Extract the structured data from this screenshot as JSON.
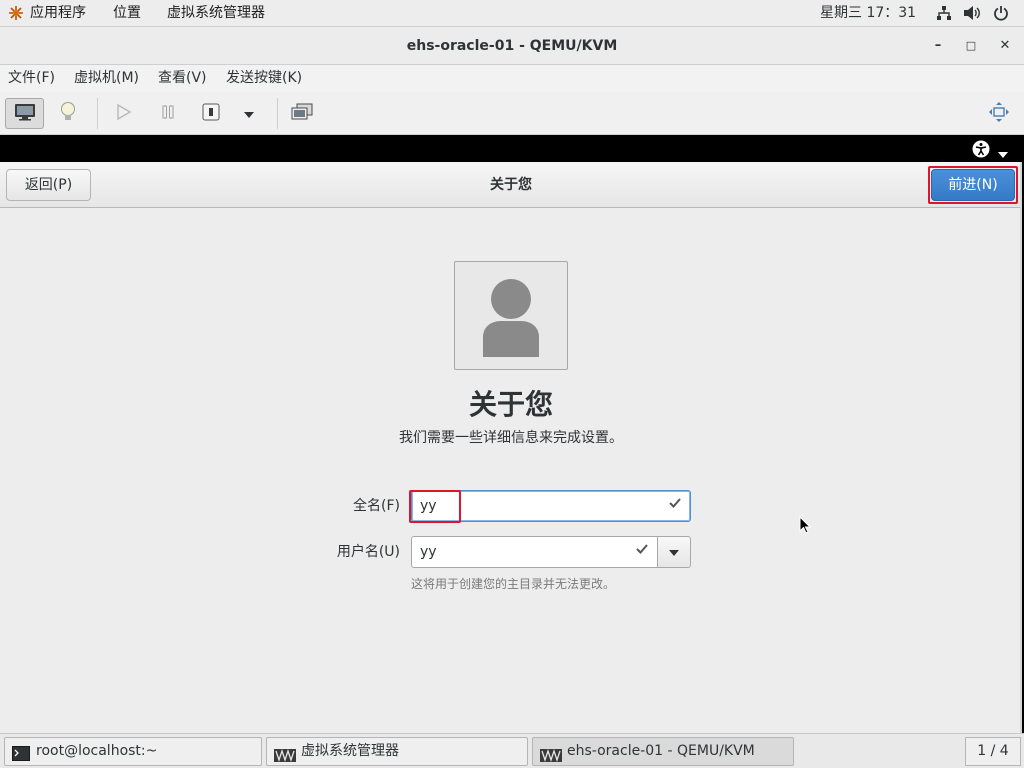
{
  "topbar": {
    "applications": "应用程序",
    "places": "位置",
    "current_app": "虚拟系统管理器",
    "clock": "星期三 17：31"
  },
  "window": {
    "title": "ehs-oracle-01 - QEMU/KVM",
    "minimize": "–",
    "maximize": "□",
    "close": "✕"
  },
  "menubar": {
    "items": [
      "文件(F)",
      "虚拟机(M)",
      "查看(V)",
      "发送按键(K)"
    ]
  },
  "installer": {
    "back_label": "返回(P)",
    "header_title": "关于您",
    "next_label": "前进(N)",
    "title": "关于您",
    "subtitle": "我们需要一些详细信息来完成设置。",
    "fullname_label": "全名(F)",
    "fullname_value": "yy",
    "username_label": "用户名(U)",
    "username_value": "yy",
    "hint": "这将用于创建您的主目录并无法更改。"
  },
  "taskbar": {
    "items": [
      "root@localhost:~",
      "虚拟系统管理器",
      "ehs-oracle-01 - QEMU/KVM"
    ],
    "workspace": "1 / 4"
  },
  "colors": {
    "accent": "#4a90d9",
    "highlight": "#e0152b"
  }
}
